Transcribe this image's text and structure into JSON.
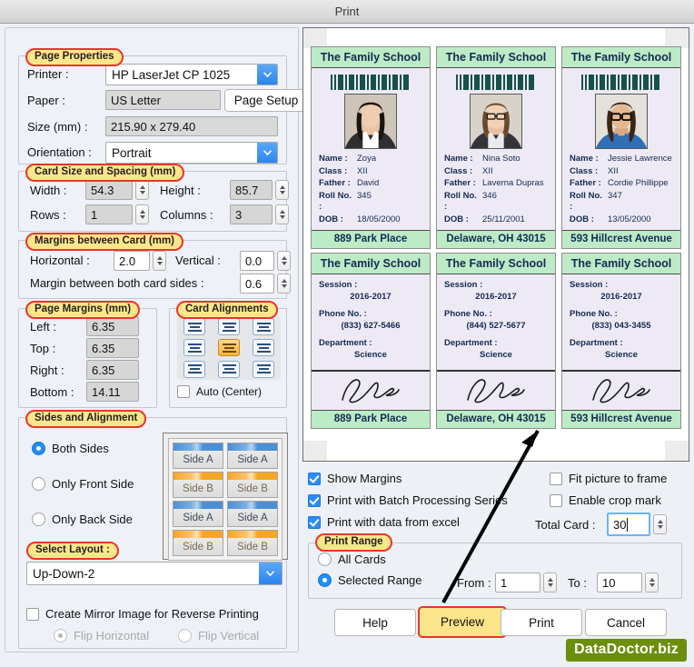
{
  "window": {
    "title": "Print"
  },
  "page_properties": {
    "legend": "Page Properties",
    "printer_label": "Printer :",
    "printer_value": "HP LaserJet CP 1025",
    "paper_label": "Paper :",
    "paper_value": "US Letter",
    "page_setup_button": "Page Setup",
    "size_label": "Size (mm) :",
    "size_value": "215.90 x 279.40",
    "orientation_label": "Orientation :",
    "orientation_value": "Portrait"
  },
  "card_size": {
    "legend": "Card Size and Spacing (mm)",
    "width_label": "Width :",
    "width_value": "54.3",
    "height_label": "Height :",
    "height_value": "85.7",
    "rows_label": "Rows :",
    "rows_value": "1",
    "columns_label": "Columns :",
    "columns_value": "3"
  },
  "margins_between_card": {
    "legend": "Margins between Card (mm)",
    "horizontal_label": "Horizontal :",
    "horizontal_value": "2.0",
    "vertical_label": "Vertical :",
    "vertical_value": "0.0",
    "both_sides_label": "Margin between both card sides :",
    "both_sides_value": "0.6"
  },
  "page_margins": {
    "legend": "Page Margins (mm)",
    "left_label": "Left :",
    "left_value": "6.35",
    "top_label": "Top :",
    "top_value": "6.35",
    "right_label": "Right :",
    "right_value": "6.35",
    "bottom_label": "Bottom :",
    "bottom_value": "14.11"
  },
  "card_alignments": {
    "legend": "Card Alignments",
    "selected_index": 4,
    "auto_center_label": "Auto (Center)",
    "auto_center_checked": false
  },
  "sides_and_alignment": {
    "legend": "Sides and Alignment",
    "options": [
      {
        "label": "Both Sides",
        "selected": true
      },
      {
        "label": "Only Front Side",
        "selected": false
      },
      {
        "label": "Only Back Side",
        "selected": false
      }
    ],
    "preview_cards": [
      "Side A",
      "Side A",
      "Side B",
      "Side B",
      "Side A",
      "Side A",
      "Side B",
      "Side B"
    ]
  },
  "select_layout": {
    "legend": "Select Layout :",
    "value": "Up-Down-2"
  },
  "mirror": {
    "label": "Create Mirror Image for Reverse Printing",
    "checked": false,
    "flip_horizontal_label": "Flip Horizontal",
    "flip_horizontal_selected": true,
    "flip_vertical_label": "Flip Vertical",
    "flip_vertical_selected": false
  },
  "options": {
    "show_margins": {
      "label": "Show Margins",
      "checked": true
    },
    "batch_processing": {
      "label": "Print with Batch Processing Series",
      "checked": true
    },
    "data_from_excel": {
      "label": "Print with data from excel",
      "checked": true
    },
    "fit_picture": {
      "label": "Fit picture to frame",
      "checked": false
    },
    "crop_mark": {
      "label": "Enable crop mark",
      "checked": false
    },
    "total_card_label": "Total Card :",
    "total_card_value": "30"
  },
  "print_range": {
    "legend": "Print Range",
    "all_cards_label": "All Cards",
    "all_cards_selected": false,
    "selected_range_label": "Selected Range",
    "selected_range_selected": true,
    "from_label": "From :",
    "from_value": "1",
    "to_label": "To :",
    "to_value": "10"
  },
  "action_buttons": {
    "help": "Help",
    "preview": "Preview",
    "print": "Print",
    "cancel": "Cancel"
  },
  "watermark": "DataDoctor.biz",
  "colors": {
    "legend_fill": "#fde68a",
    "legend_border": "#e8352c",
    "card_header_green": "#bdebc6",
    "card_body_lilac": "#eeeaf5",
    "card_text_navy": "#142a52",
    "accent_blue": "#2d8cf6",
    "highlight_button": "#fbe489",
    "watermark_bg": "#6b8e0b"
  },
  "card_preview": {
    "front_cards": [
      {
        "school": "The Family School",
        "name_label": "Name :",
        "name_value": "Zoya",
        "class_label": "Class :",
        "class_value": "XII",
        "father_label": "Father :",
        "father_value": "David",
        "roll_label": "Roll No. :",
        "roll_value": "345",
        "dob_label": "DOB :",
        "dob_value": "18/05/2000",
        "address": "889 Park Place"
      },
      {
        "school": "The Family School",
        "name_label": "Name :",
        "name_value": "Nina Soto",
        "class_label": "Class :",
        "class_value": "XII",
        "father_label": "Father :",
        "father_value": "Laverna Dupras",
        "roll_label": "Roll No. :",
        "roll_value": "346",
        "dob_label": "DOB :",
        "dob_value": "25/11/2001",
        "address": "Delaware, OH 43015"
      },
      {
        "school": "The Family School",
        "name_label": "Name :",
        "name_value": "Jessie Lawrence",
        "class_label": "Class :",
        "class_value": "XII",
        "father_label": "Father :",
        "father_value": "Cordie Phillippe",
        "roll_label": "Roll No. :",
        "roll_value": "347",
        "dob_label": "DOB :",
        "dob_value": "13/05/2000",
        "address": "593 Hillcrest Avenue"
      }
    ],
    "back_cards": [
      {
        "school": "The Family School",
        "session_label": "Session :",
        "session_value": "2016-2017",
        "phone_label": "Phone No. :",
        "phone_value": "(833) 627-5466",
        "dept_label": "Department :",
        "dept_value": "Science",
        "address": "889 Park Place"
      },
      {
        "school": "The Family School",
        "session_label": "Session :",
        "session_value": "2016-2017",
        "phone_label": "Phone No. :",
        "phone_value": "(844) 527-5677",
        "dept_label": "Department :",
        "dept_value": "Science",
        "address": "Delaware, OH 43015"
      },
      {
        "school": "The Family School",
        "session_label": "Session :",
        "session_value": "2016-2017",
        "phone_label": "Phone No. :",
        "phone_value": "(833) 043-3455",
        "dept_label": "Department :",
        "dept_value": "Science",
        "address": "593 Hillcrest Avenue"
      }
    ]
  }
}
